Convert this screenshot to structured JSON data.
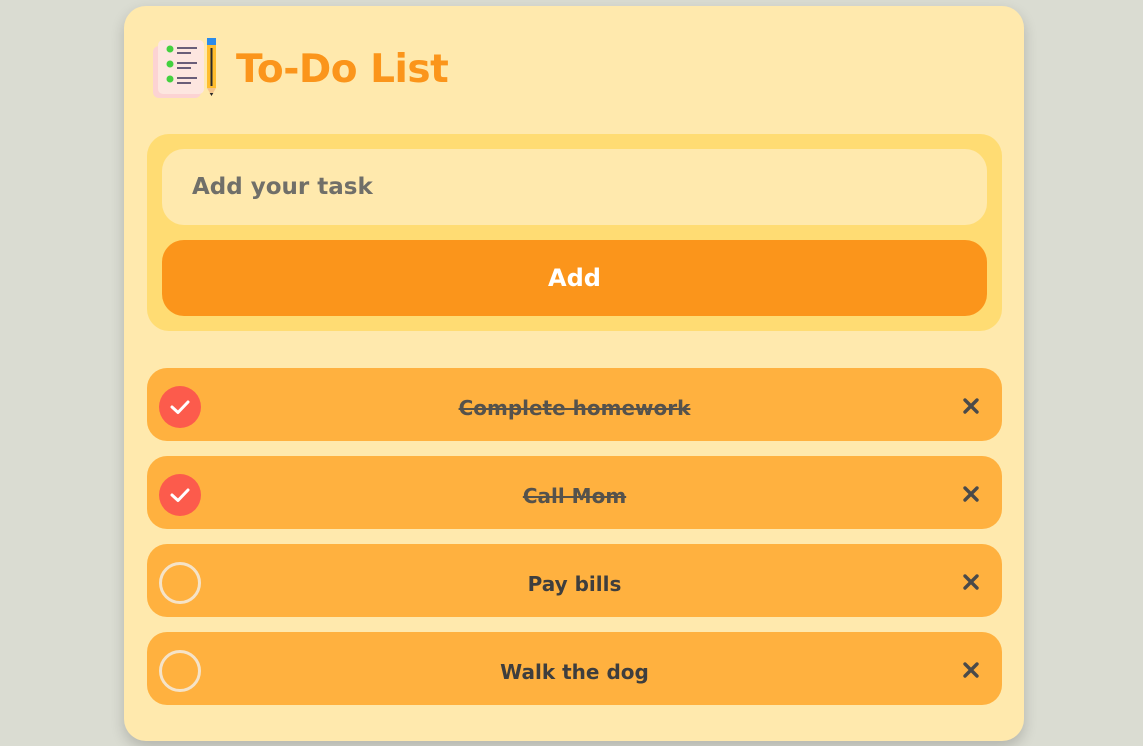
{
  "app": {
    "title": "To-Do List",
    "logo_icon": "notepad-with-pencil-icon"
  },
  "input": {
    "placeholder": "Add your task",
    "value": ""
  },
  "add_button": {
    "label": "Add"
  },
  "tasks": [
    {
      "text": "Complete homework",
      "completed": true
    },
    {
      "text": "Call Mom",
      "completed": true
    },
    {
      "text": "Pay bills",
      "completed": false
    },
    {
      "text": "Walk the dog",
      "completed": false
    }
  ],
  "colors": {
    "background": "#dadcd2",
    "card": "#ffe9ad",
    "input_panel": "#ffdc73",
    "accent": "#fb951b",
    "task_item": "#ffb13f",
    "checked": "#fc5b4c",
    "text_dark": "#3e3e3e"
  }
}
